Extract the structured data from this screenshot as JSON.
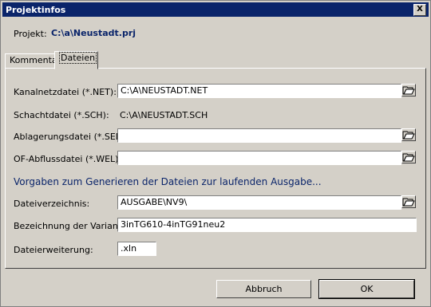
{
  "window": {
    "title": "Projektinfos",
    "close_label": "X"
  },
  "project": {
    "label": "Projekt:",
    "path": "C:\\a\\Neustadt.prj"
  },
  "tabs": [
    {
      "label": "Kommentar"
    },
    {
      "label": "Dateien"
    }
  ],
  "fields": {
    "kanalnetz": {
      "label": "Kanalnetzdatei (*.NET):",
      "value": "C:\\A\\NEUSTADT.NET"
    },
    "schacht": {
      "label": "Schachtdatei (*.SCH):",
      "value": "C:\\A\\NEUSTADT.SCH"
    },
    "ablagerung": {
      "label": "Ablagerungsdatei (*.SED):",
      "value": ""
    },
    "ofabfluss": {
      "label": "OF-Abflussdatei (*.WEL):",
      "value": ""
    }
  },
  "section": {
    "heading": "Vorgaben zum Generieren der Dateien zur laufenden Ausgabe..."
  },
  "output": {
    "verzeichnis": {
      "label": "Dateiverzeichnis:",
      "value": "AUSGABE\\NV9\\"
    },
    "variante": {
      "label": "Bezeichnung der Variante:",
      "value": "3inTG610-4inTG91neu2"
    },
    "erweiterung": {
      "label": "Dateierweiterung:",
      "value": ".xln"
    }
  },
  "buttons": {
    "cancel": "Abbruch",
    "ok": "OK"
  },
  "icons": {
    "browse": "folder-open-icon"
  }
}
